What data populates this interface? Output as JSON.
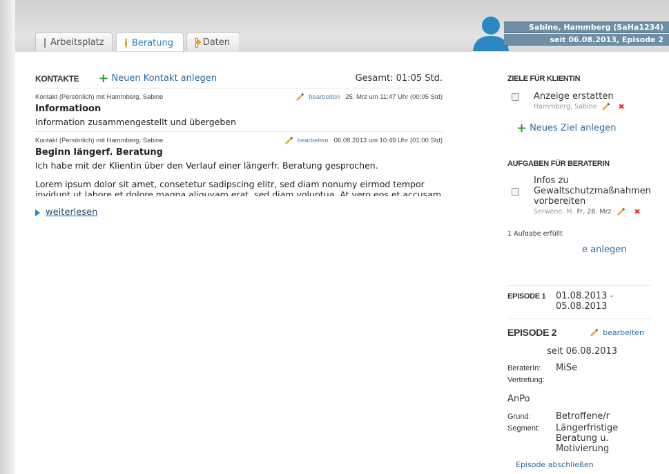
{
  "tabs": [
    {
      "label": "Arbeitsplatz",
      "icon": "workplace-icon",
      "active": false
    },
    {
      "label": "Beratung",
      "icon": "speech-bubble-icon",
      "active": true
    },
    {
      "label": "Daten",
      "icon": "document-edit-icon",
      "active": false
    }
  ],
  "user": {
    "name_line": "Sabine, Hammberg (SaHa1234)",
    "episode_line": "seit 06.08.2013, Episode 2"
  },
  "kontakte": {
    "heading": "KONTAKTE",
    "add_label": "Neuen Kontakt anlegen",
    "total": "Gesamt: 01:05 Std.",
    "entries": [
      {
        "meta": "Kontakt (Persönlich) mit Hammberg, Sabine",
        "edit": "bearbeiten",
        "date": "25. Mrz um 11:47 Uhr (00:05 Std)",
        "title": "Informatioon",
        "text": "Information zusammengestellt und übergeben"
      },
      {
        "meta": "Kontakt (Persönlich) mit Hammberg, Sabine",
        "edit": "bearbeiten",
        "date": "06.08.2013 um 10:49 Uhr (01:00 Std)",
        "title": "Beginn längerf. Beratung",
        "text": "Ich habe mit der Klientin über den Verlauf einer längerfr. Beratung gesprochen.",
        "text2": "Lorem ipsum dolor sit amet, consetetur sadipscing elitr, sed diam nonumy eirmod tempor invidunt ut labore et dolore magna aliquyam erat, sed diam voluptua. At vero eos et accusam et"
      }
    ],
    "read_more": "weiterlesen"
  },
  "ziele": {
    "heading": "ZIELE FÜR KLIENTIN",
    "items": [
      {
        "text": "Anzeige erstatten",
        "sub": "Hammberg, Sabine"
      }
    ],
    "add_label": "Neues Ziel anlegen"
  },
  "aufgaben": {
    "heading": "AUFGABEN FÜR BERATERIN",
    "items": [
      {
        "text": "Infos zu Gewaltschutzmaßnahmen vorbereiten",
        "sub_user": "Serwene, M.",
        "sub_date": "Fr, 28. Mrz"
      }
    ],
    "done": "1 Aufgabe erfüllt",
    "add_label_partial": "e anlegen"
  },
  "episoden": {
    "ep1_label": "EPISODE 1",
    "ep1_dates": "01.08.2013 - 05.08.2013",
    "ep2_label": "EPISODE 2",
    "ep2_edit": "bearbeiten",
    "ep2_since": "seit 06.08.2013",
    "berater_label": "BeraterIn:",
    "berater_value": "MiSe",
    "vertretung_label": "Vertretung:",
    "vertretung_value": "AnPo",
    "grund_label": "Grund:",
    "grund_value": "Betroffene/r",
    "segment_label": "Segment:",
    "segment_value": "Längerfristige Beratung u. Motivierung",
    "close_label": "Episode abschließen"
  }
}
